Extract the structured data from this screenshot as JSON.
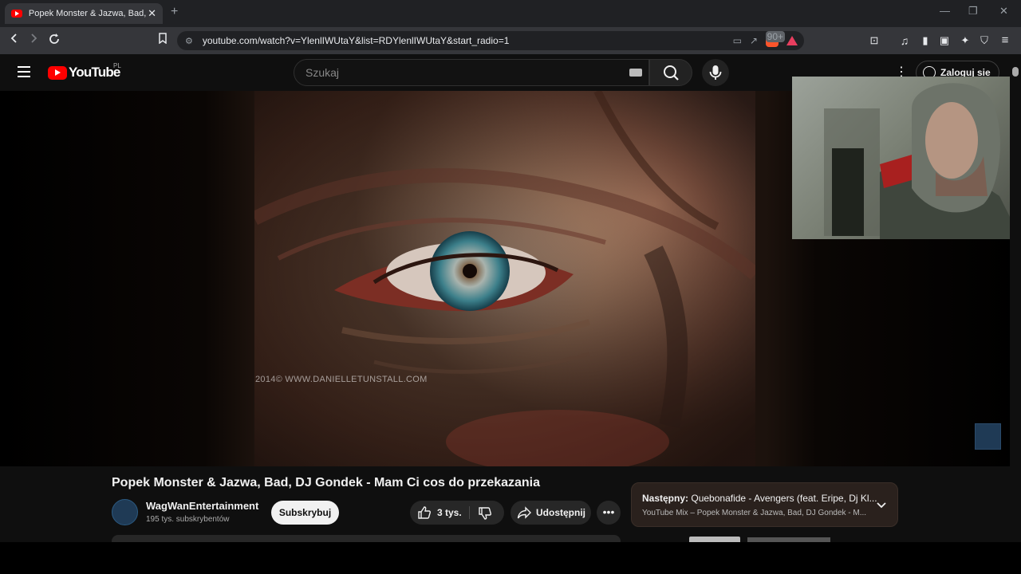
{
  "browser": {
    "tab_title": "Popek Monster & Jazwa, Bad, DJ Gondek - Mam Ci cos do przekazania",
    "url": "youtube.com/watch?v=YlenlIWUtaY&list=RDYlenlIWUtaY&start_radio=1",
    "brave_badge": "90+"
  },
  "youtube": {
    "logo_text": "YouTube",
    "country_code": "PL",
    "search_placeholder": "Szukaj",
    "signin_label": "Zaloguj sie"
  },
  "player": {
    "watermark": "2014© WWW.DANIELLETUNSTALL.COM"
  },
  "video": {
    "title": "Popek Monster & Jazwa, Bad, DJ Gondek - Mam Ci cos do przekazania",
    "channel_name": "WagWanEntertainment",
    "subscribers": "195 tys. subskrybentów",
    "subscribe_label": "Subskrybuj",
    "likes": "3 tys.",
    "share_label": "Udostępnij"
  },
  "up_next": {
    "label": "Następny:",
    "title": "Quebonafide - Avengers (feat. Eripe, Dj Kl...",
    "subtitle": "YouTube Mix – Popek Monster & Jazwa, Bad, DJ Gondek - M..."
  }
}
